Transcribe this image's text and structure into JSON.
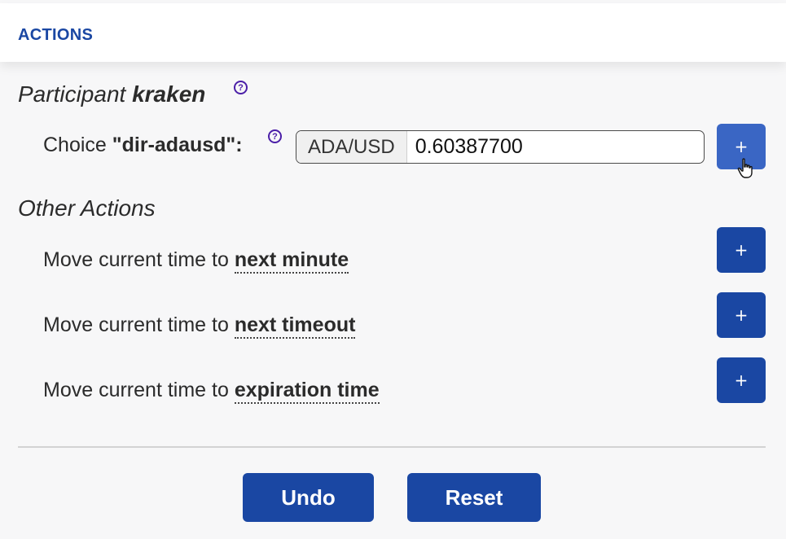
{
  "panel": {
    "title": "ACTIONS"
  },
  "participant": {
    "prefix": "Participant",
    "name": "kraken",
    "help_icon": "?"
  },
  "choice": {
    "prefix": "Choice",
    "name": "\"dir-adausd\":",
    "help_icon": "?",
    "input_prefix": "ADA/USD",
    "input_value": "0.60387700",
    "add_label": "+"
  },
  "other_actions": {
    "title": "Other Actions",
    "items": [
      {
        "text": "Move current time to",
        "target": "next minute",
        "add_label": "+"
      },
      {
        "text": "Move current time to",
        "target": "next timeout",
        "add_label": "+"
      },
      {
        "text": "Move current time to",
        "target": "expiration time",
        "add_label": "+"
      }
    ]
  },
  "footer": {
    "undo_label": "Undo",
    "reset_label": "Reset"
  },
  "colors": {
    "accent": "#1a47a3",
    "accent_hover": "#3a66c4",
    "help_icon": "#4b1fa8"
  }
}
